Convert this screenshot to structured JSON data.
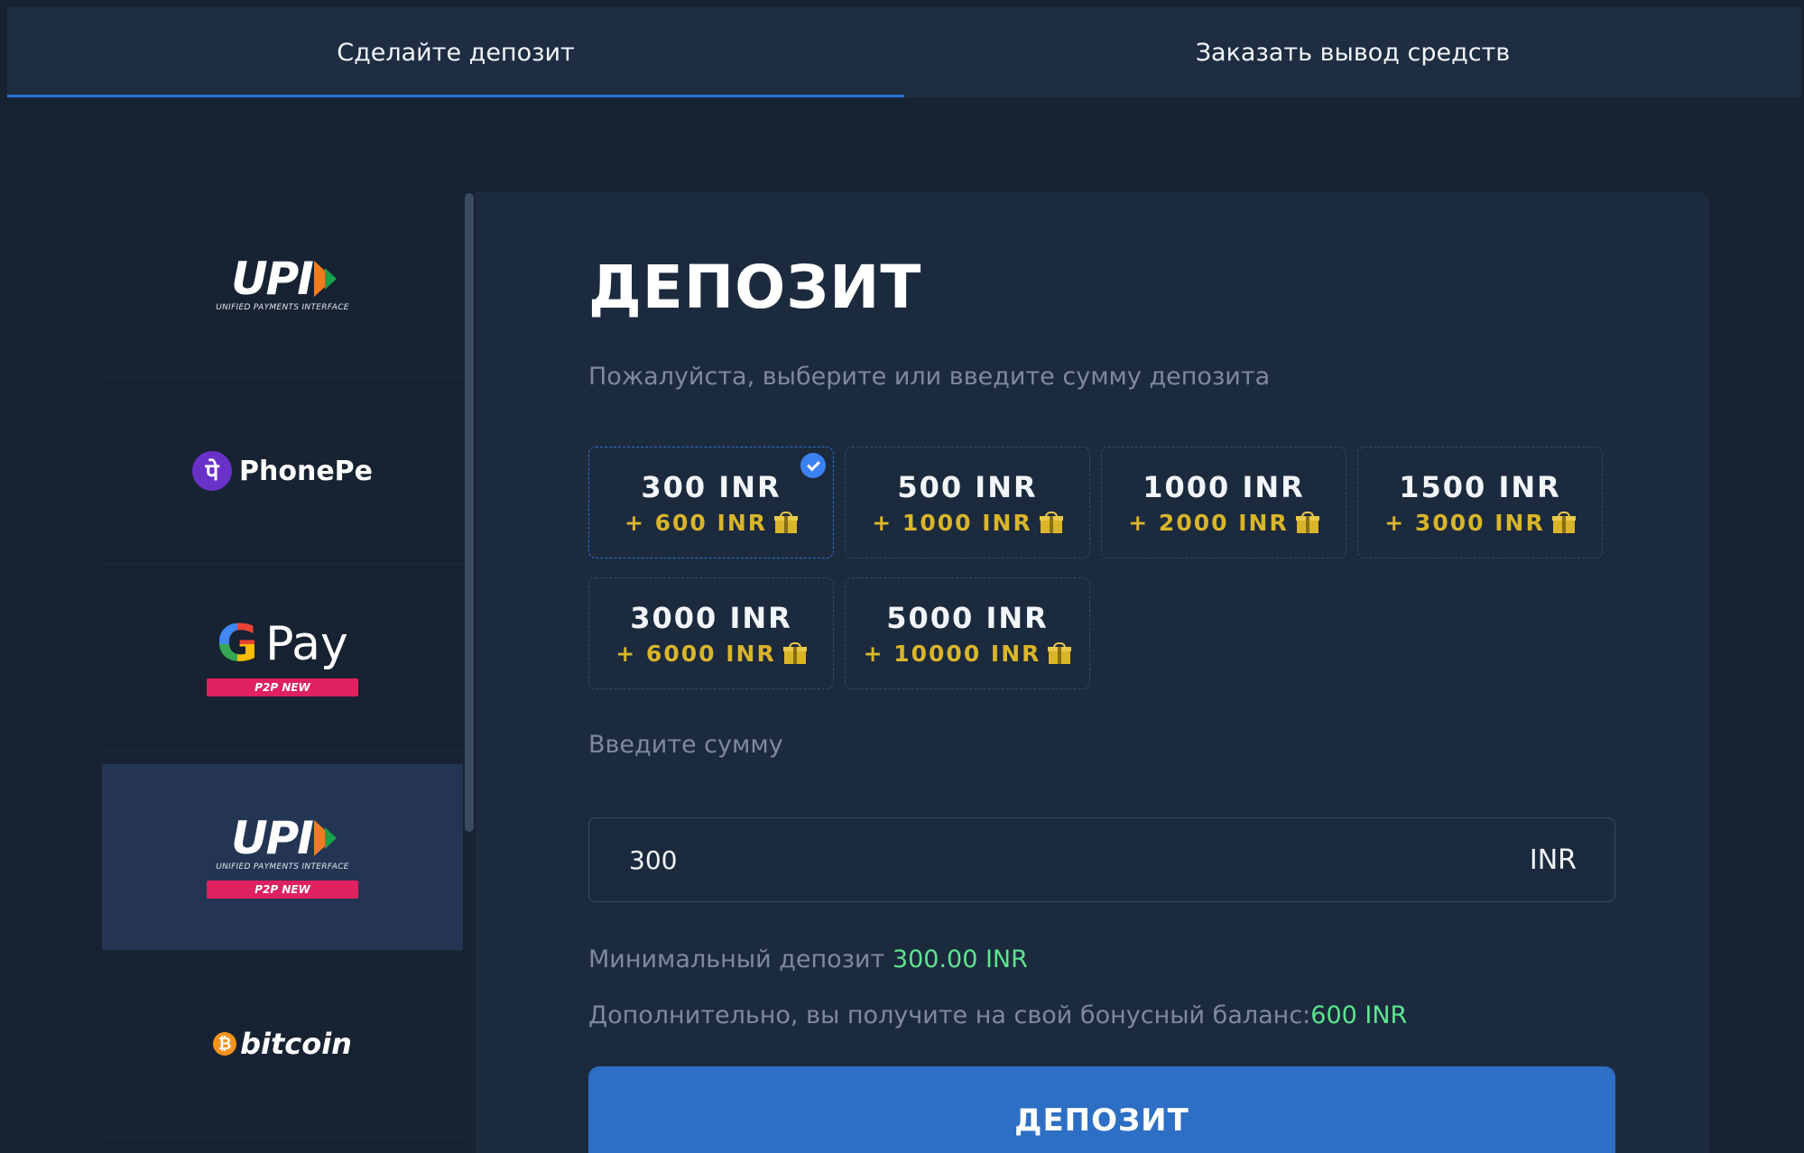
{
  "tabs": [
    {
      "label": "Сделайте депозит",
      "active": true
    },
    {
      "label": "Заказать вывод средств",
      "active": false
    }
  ],
  "methods": {
    "upi_1": {
      "word": "UPI",
      "sub": "UNIFIED PAYMENTS INTERFACE"
    },
    "phonepe": {
      "icon_glyph": "पे",
      "word": "PhonePe"
    },
    "gpay": {
      "g": "G",
      "word": "Pay",
      "badge": "P2P NEW"
    },
    "upi_2": {
      "word": "UPI",
      "sub": "UNIFIED PAYMENTS INTERFACE",
      "badge": "P2P NEW",
      "active": true
    },
    "bitcoin": {
      "coin": "₿",
      "word": "bitcoin"
    }
  },
  "deposit": {
    "title": "ДЕПОЗИТ",
    "subtitle": "Пожалуйста, выберите или введите сумму депозита",
    "amounts": [
      {
        "main": "300 INR",
        "bonus": "+ 600 INR",
        "selected": true
      },
      {
        "main": "500 INR",
        "bonus": "+ 1000 INR",
        "selected": false
      },
      {
        "main": "1000 INR",
        "bonus": "+ 2000 INR",
        "selected": false
      },
      {
        "main": "1500 INR",
        "bonus": "+ 3000 INR",
        "selected": false
      },
      {
        "main": "3000 INR",
        "bonus": "+ 6000 INR",
        "selected": false
      },
      {
        "main": "5000 INR",
        "bonus": "+ 10000 INR",
        "selected": false
      }
    ],
    "enter_label": "Введите сумму",
    "input_value": "300",
    "currency": "INR",
    "min_label": "Минимальный депозит ",
    "min_value": "300.00 INR",
    "bonus_label": "Дополнительно, вы получите на свой бонусный баланс:",
    "bonus_value": "600 INR",
    "button_label": "ДЕПОЗИТ"
  },
  "colors": {
    "accent": "#2d6fc4",
    "highlight_green": "#5ce58e",
    "bonus_gold": "#d9b52b",
    "badge_pink": "#e0215f"
  }
}
